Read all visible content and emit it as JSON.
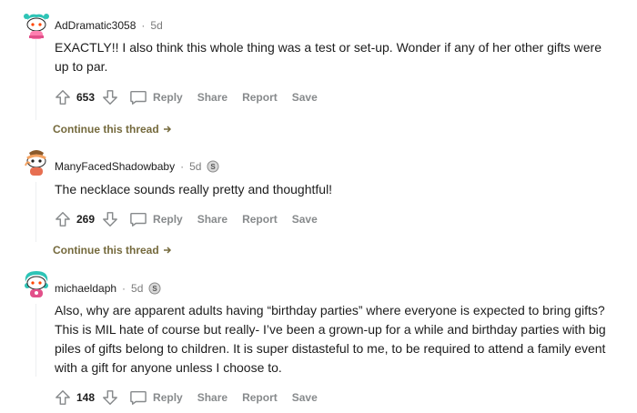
{
  "comments": [
    {
      "username": "AdDramatic3058",
      "separator": "·",
      "age": "5d",
      "text": "EXACTLY!! I also think this whole thing was a test or set-up. Wonder if any of her other gifts were up to par.",
      "score": "653",
      "reply": "Reply",
      "share": "Share",
      "report": "Report",
      "save": "Save",
      "continue": "Continue this thread"
    },
    {
      "username": "ManyFacedShadowbaby",
      "separator": "·",
      "age": "5d",
      "text": "The necklace sounds really pretty and thoughtful!",
      "score": "269",
      "reply": "Reply",
      "share": "Share",
      "report": "Report",
      "save": "Save",
      "continue": "Continue this thread"
    },
    {
      "username": "michaeldaph",
      "separator": "·",
      "age": "5d",
      "text": "Also, why are apparent adults having “birthday parties” where everyone is expected to bring gifts? This is MIL hate of course but really- I’ve been a grown-up for a while and birthday parties with big piles of gifts belong to children. It is super distasteful to me, to be required to attend a family event with a gift for anyone unless I choose to.",
      "score": "148",
      "reply": "Reply",
      "share": "Share",
      "report": "Report",
      "save": "Save"
    }
  ],
  "icons": {
    "upvote": "arrow-up-icon",
    "downvote": "arrow-down-icon",
    "reply": "speech-bubble-icon",
    "continue": "arrow-right-icon",
    "badge": "silver-award-icon"
  },
  "colors": {
    "continue_link": "#756a3d",
    "muted": "#878a8c"
  }
}
